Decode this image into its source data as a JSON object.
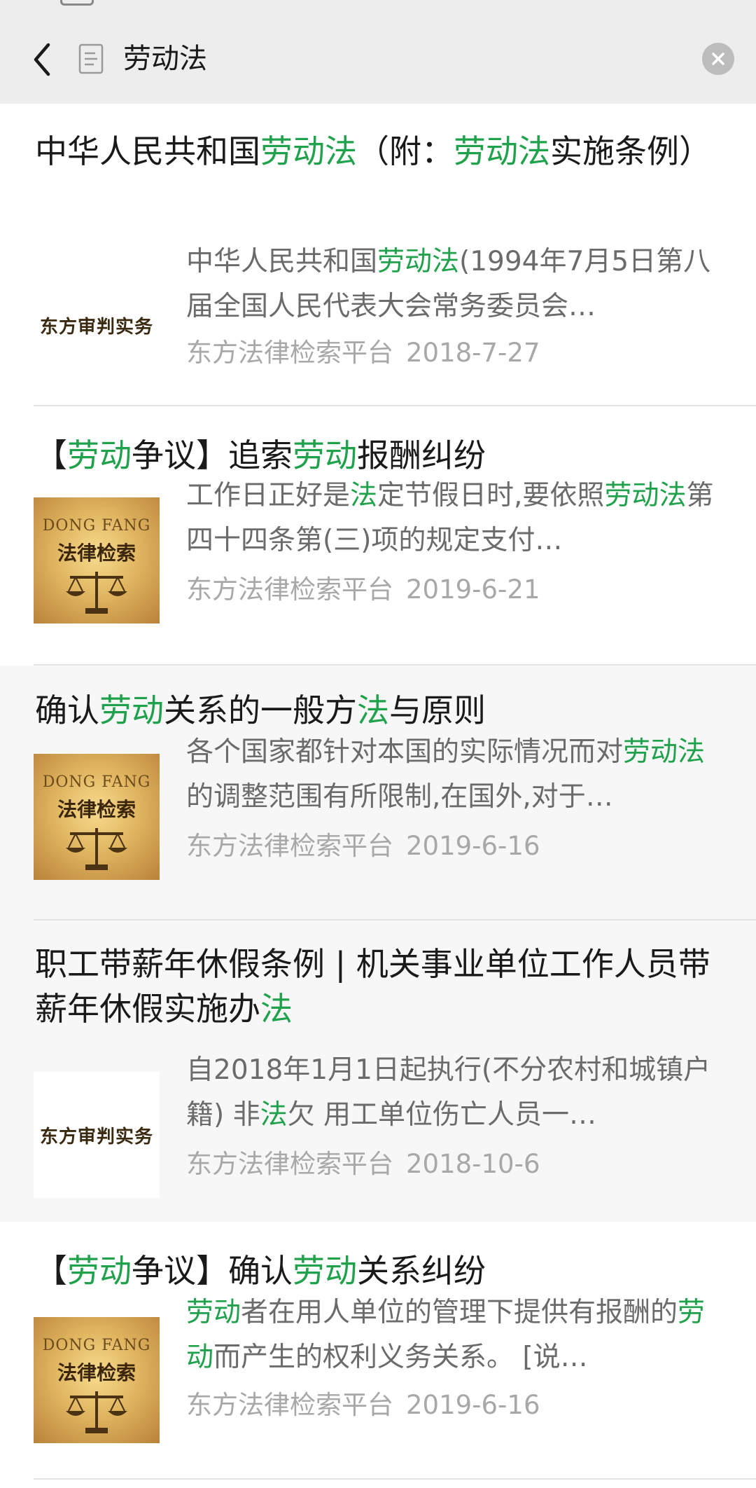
{
  "header": {
    "back_icon": "chevron-left-icon",
    "doc_icon": "document-icon",
    "query": "劳动法",
    "clear_icon": "clear-circle-icon"
  },
  "colors": {
    "highlight": "#20a14b",
    "title": "#1a1a1a",
    "snippet": "#6b6b6b",
    "meta": "#a8a8a8"
  },
  "results": [
    {
      "title_parts": [
        [
          "中华人民共和国",
          false
        ],
        [
          "劳动法",
          true
        ],
        [
          "（附：",
          false
        ],
        [
          "劳动法",
          true
        ],
        [
          "实施条例）",
          false
        ]
      ],
      "thumb": "text-logo",
      "thumb_text": "东方审判实务",
      "snippet_parts": [
        [
          "中华人民共和国",
          false
        ],
        [
          "劳动法",
          true
        ],
        [
          "(1994年7月5日第八届全国人民代表大会常务委员会…",
          false
        ]
      ],
      "source": "东方法律检索平台",
      "date": "2018-7-27"
    },
    {
      "title_parts": [
        [
          "【",
          false
        ],
        [
          "劳动",
          true
        ],
        [
          "争议】追索",
          false
        ],
        [
          "劳动",
          true
        ],
        [
          "报酬纠纷",
          false
        ]
      ],
      "thumb": "scale-logo",
      "thumb_en": "DONG FANG",
      "thumb_cn": "法律检索",
      "snippet_parts": [
        [
          "工作日正好是",
          false
        ],
        [
          "法",
          true
        ],
        [
          "定节假日时,要依照",
          false
        ],
        [
          "劳动法",
          true
        ],
        [
          "第四十四条第(三)项的规定支付…",
          false
        ]
      ],
      "source": "东方法律检索平台",
      "date": "2019-6-21"
    },
    {
      "title_parts": [
        [
          "确认",
          false
        ],
        [
          "劳动",
          true
        ],
        [
          "关系的一般方",
          false
        ],
        [
          "法",
          true
        ],
        [
          "与原则",
          false
        ]
      ],
      "thumb": "scale-logo",
      "thumb_en": "DONG FANG",
      "thumb_cn": "法律检索",
      "snippet_parts": [
        [
          "各个国家都针对本国的实际情况而对",
          false
        ],
        [
          "劳动法",
          true
        ],
        [
          "的调整范围有所限制,在国外,对于…",
          false
        ]
      ],
      "source": "东方法律检索平台",
      "date": "2019-6-16"
    },
    {
      "title_parts": [
        [
          "职工带薪年休假条例 | 机关事业单位工作人员带薪年休假实施办",
          false
        ],
        [
          "法",
          true
        ]
      ],
      "thumb": "text-logo",
      "thumb_text": "东方审判实务",
      "snippet_parts": [
        [
          "自2018年1月1日起执行(不分农村和城镇户籍) 非",
          false
        ],
        [
          "法",
          true
        ],
        [
          "欠 用工单位伤亡人员一…",
          false
        ]
      ],
      "source": "东方法律检索平台",
      "date": "2018-10-6"
    },
    {
      "title_parts": [
        [
          "【",
          false
        ],
        [
          "劳动",
          true
        ],
        [
          "争议】确认",
          false
        ],
        [
          "劳动",
          true
        ],
        [
          "关系纠纷",
          false
        ]
      ],
      "thumb": "scale-logo",
      "thumb_en": "DONG FANG",
      "thumb_cn": "法律检索",
      "snippet_parts": [
        [
          "劳动",
          true
        ],
        [
          "者在用人单位的管理下提供有报酬的",
          false
        ],
        [
          "劳动",
          true
        ],
        [
          "而产生的权利义务关系。 [说…",
          false
        ]
      ],
      "source": "东方法律检索平台",
      "date": "2019-6-16"
    }
  ]
}
